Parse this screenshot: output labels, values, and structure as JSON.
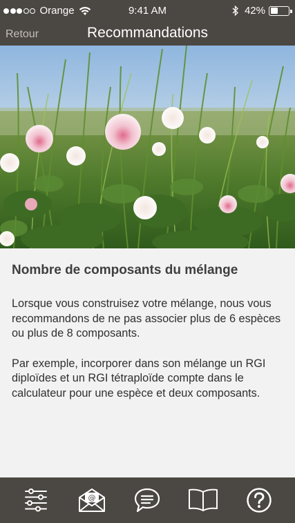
{
  "status_bar": {
    "carrier": "Orange",
    "time": "9:41 AM",
    "battery_percent": "42%",
    "battery_level": 0.42,
    "signal_bars": 3,
    "signal_total": 5
  },
  "nav": {
    "back_label": "Retour",
    "title": "Recommandations"
  },
  "content": {
    "title": "Nombre de composants du mélange",
    "paragraphs": [
      "Lorsque vous construisez votre mélange, nous vous recommandons de ne pas associer plus de 6 espèces ou plus de 8 composants.",
      "Par exemple, incorporer dans son mélange un RGI diploïdes et un RGI tétraploïde compte dans le calculateur pour une espèce et deux composants."
    ]
  },
  "tab_bar": {
    "items": [
      {
        "icon": "sliders-icon"
      },
      {
        "icon": "mail-icon"
      },
      {
        "icon": "chat-icon"
      },
      {
        "icon": "book-icon"
      },
      {
        "icon": "help-icon"
      }
    ]
  },
  "colors": {
    "bar_background": "#4b4742",
    "content_background": "#f2f2f2",
    "back_text": "#c4bfb8",
    "icon": "#ffffff"
  }
}
